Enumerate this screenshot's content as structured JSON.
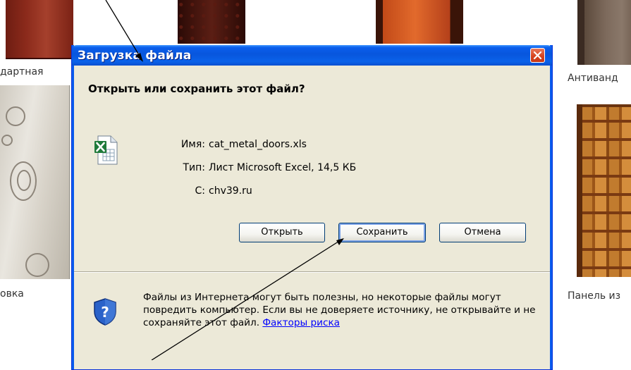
{
  "background_page": {
    "captions": {
      "standard": "дартная",
      "antivandal": "Антиванд",
      "kovka": "овка",
      "panel": "Панель из"
    }
  },
  "dialog": {
    "title": "Загрузка файла",
    "question": "Открыть или сохранить этот файл?",
    "file_icon": "excel-file-icon",
    "info": [
      {
        "label": "Имя:",
        "value": "cat_metal_doors.xls"
      },
      {
        "label": "Тип:",
        "value": "Лист Microsoft Excel, 14,5 КБ"
      },
      {
        "label": "С:",
        "value": "chv39.ru"
      }
    ],
    "buttons": {
      "open": "Открыть",
      "save": "Сохранить",
      "cancel": "Отмена"
    },
    "warning_text": "Файлы из Интернета могут быть полезны, но некоторые файлы могут повредить компьютер. Если вы не доверяете источнику, не открывайте и не сохраняйте этот файл.",
    "risk_link": "Факторы риска",
    "shield_icon": "security-shield-question-icon"
  },
  "colors": {
    "titlebar": "#0a5eeb",
    "dialog_bg": "#ece9d8",
    "close_button": "#d5411c",
    "link": "#0000ff"
  }
}
